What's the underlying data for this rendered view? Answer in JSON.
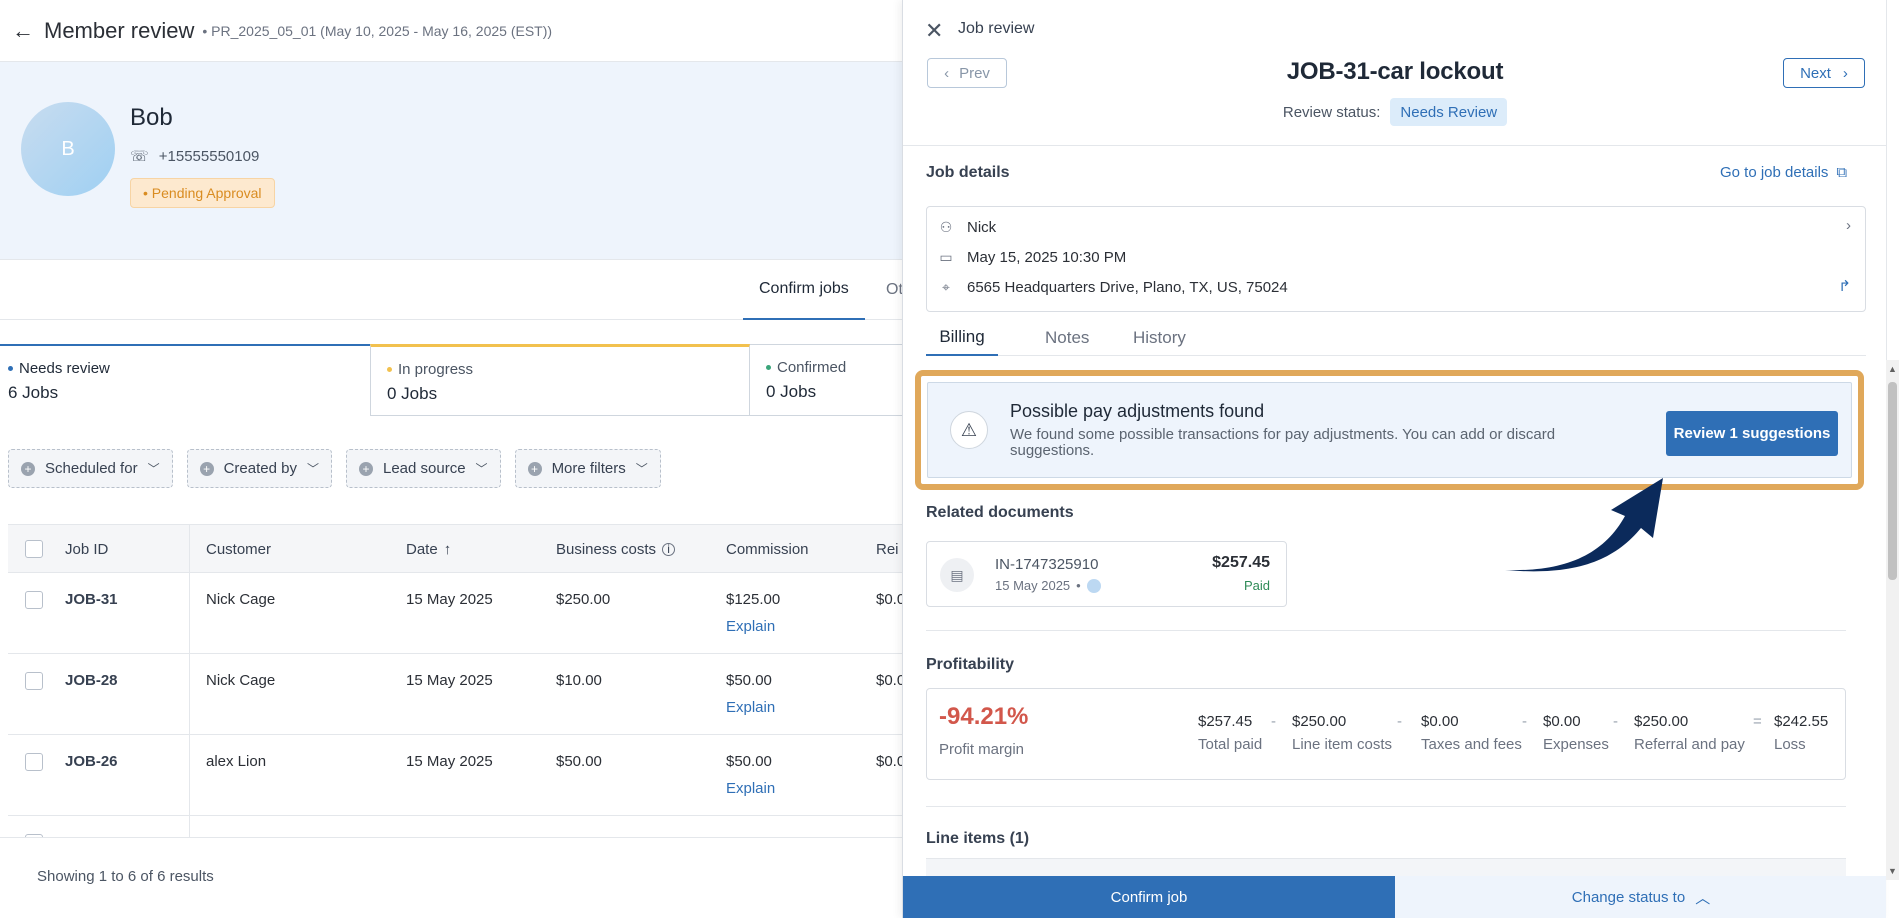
{
  "member": {
    "back_icon": "arrow-left-icon",
    "title": "Member review",
    "period": "• PR_2025_05_01 (May 10, 2025 - May 16, 2025 (EST))",
    "avatar_initial": "B",
    "name": "Bob",
    "phone": "+15555550109",
    "status": "• Pending Approval"
  },
  "tabs": {
    "confirm": "Confirm jobs",
    "other": "Ot"
  },
  "stats": [
    {
      "label": "Needs review",
      "value": "6 Jobs",
      "color": "#2f6fb6"
    },
    {
      "label": "In progress",
      "value": "0 Jobs",
      "color": "#f2c14e"
    },
    {
      "label": "Confirmed",
      "value": "0 Jobs",
      "color": "#3aa57a"
    }
  ],
  "filters": [
    "Scheduled for",
    "Created by",
    "Lead source",
    "More filters"
  ],
  "table": {
    "headers": [
      "Job ID",
      "Customer",
      "Date",
      "Business costs",
      "Commission",
      "Rei"
    ],
    "rows": [
      {
        "id": "JOB-31",
        "customer": "Nick Cage",
        "date": "15 May 2025",
        "cost": "$250.00",
        "commission": "$125.00",
        "explain": "Explain",
        "rei": "$0.0"
      },
      {
        "id": "JOB-28",
        "customer": "Nick Cage",
        "date": "15 May 2025",
        "cost": "$10.00",
        "commission": "$50.00",
        "explain": "Explain",
        "rei": "$0.0"
      },
      {
        "id": "JOB-26",
        "customer": "alex Lion",
        "date": "15 May 2025",
        "cost": "$50.00",
        "commission": "$50.00",
        "explain": "Explain",
        "rei": "$0.0"
      }
    ],
    "showing": "Showing 1 to 6 of 6 results"
  },
  "drawer": {
    "header": "Job review",
    "prev": "Prev",
    "next": "Next",
    "job_title": "JOB-31-car lockout",
    "review_status_label": "Review status:",
    "review_status": "Needs Review",
    "job_details_title": "Job details",
    "go_to_details": "Go to job details",
    "technician": "Nick",
    "datetime": "May 15, 2025 10:30 PM",
    "address": "6565 Headquarters Drive, Plano, TX, US, 75024",
    "billing_tabs": [
      "Billing",
      "Notes",
      "History"
    ],
    "alert": {
      "title": "Possible pay adjustments found",
      "body": "We found some possible transactions for pay adjustments. You can add or discard suggestions.",
      "button": "Review 1 suggestions"
    },
    "related_docs_title": "Related documents",
    "doc": {
      "number": "IN-1747325910",
      "date": "15 May 2025",
      "amount": "$257.45",
      "status": "Paid"
    },
    "profitability_title": "Profitability",
    "profit": {
      "margin": "-94.21%",
      "margin_label": "Profit margin",
      "items": [
        {
          "value": "$257.45",
          "label": "Total paid"
        },
        {
          "value": "$250.00",
          "label": "Line item costs"
        },
        {
          "value": "$0.00",
          "label": "Taxes and fees"
        },
        {
          "value": "$0.00",
          "label": "Expenses"
        },
        {
          "value": "$250.00",
          "label": "Referral and pay"
        },
        {
          "value": "$242.55",
          "label": "Loss"
        }
      ],
      "ops": [
        "-",
        "-",
        "-",
        "-",
        "="
      ]
    },
    "line_items_title": "Line items (1)",
    "confirm": "Confirm job",
    "change_status": "Change status to"
  },
  "colors": {
    "accent": "#2f6fb6",
    "highlight_border": "#e0a85a",
    "arrow": "#0b2a5b",
    "loss": "#d2574b"
  }
}
